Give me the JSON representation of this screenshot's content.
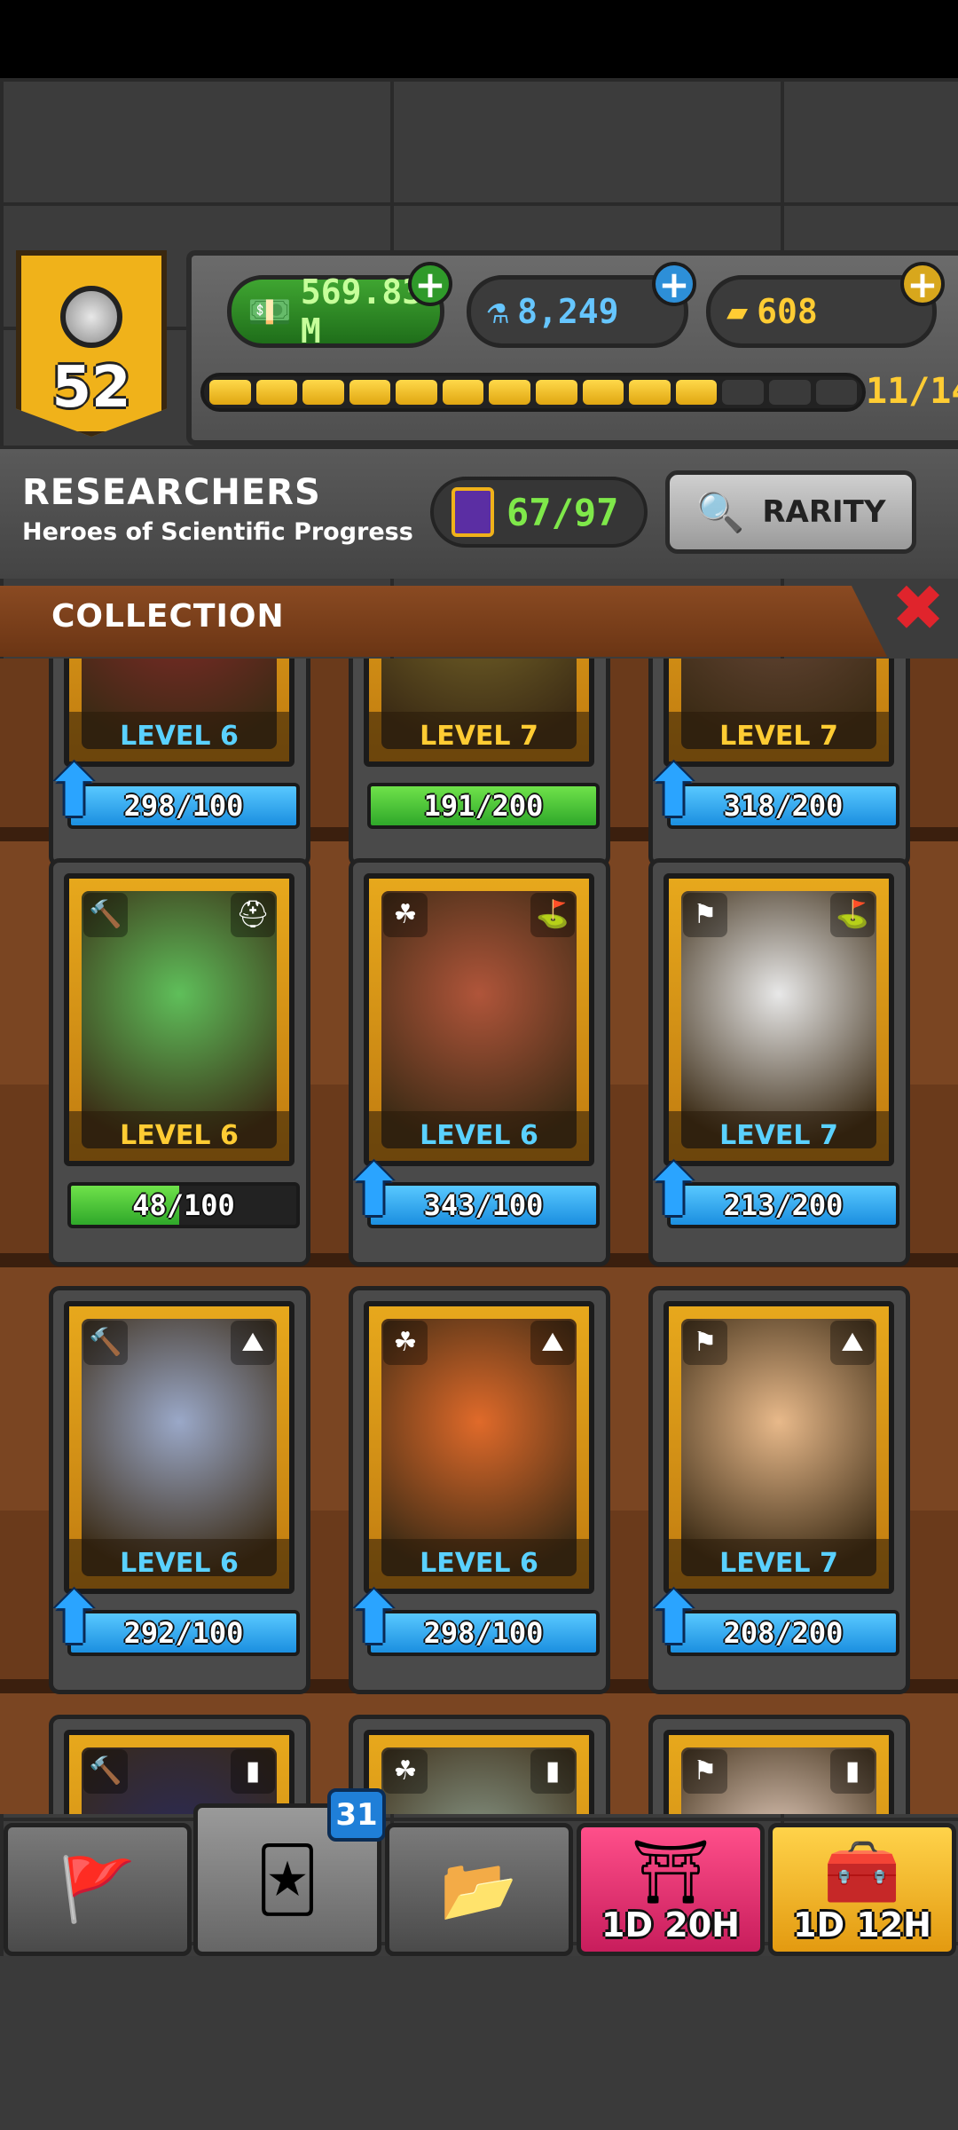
{
  "player": {
    "level": "52"
  },
  "currencies": {
    "cash": "569.83 M",
    "science": "8,249",
    "gold": "608"
  },
  "progress": {
    "text": "11/14",
    "filled": 11,
    "total": 14
  },
  "header": {
    "title": "RESEARCHERS",
    "subtitle": "Heroes of Scientific Progress",
    "cards_count": "67/97",
    "rarity_label": "RARITY"
  },
  "collection": {
    "label": "COLLECTION",
    "close": "✖"
  },
  "cards": [
    {
      "level": "LEVEL 6",
      "level_color": "blue",
      "progress": "298/100",
      "bar": "blue",
      "upgrade": true,
      "tint": "#8a2a2a"
    },
    {
      "level": "LEVEL 7",
      "level_color": "gold",
      "progress": "191/200",
      "bar": "green-full",
      "upgrade": false,
      "tint": "#7b6a2a"
    },
    {
      "level": "LEVEL 7",
      "level_color": "gold",
      "progress": "318/200",
      "bar": "blue",
      "upgrade": true,
      "tint": "#6b4a3a"
    },
    {
      "level": "LEVEL 6",
      "level_color": "gold",
      "progress": "48/100",
      "fill_fraction": 0.48,
      "bar": "partial",
      "upgrade": false,
      "tint": "#5fbf5a",
      "chip_l": "🔨",
      "chip_r": "⛑"
    },
    {
      "level": "LEVEL 6",
      "level_color": "blue",
      "progress": "343/100",
      "bar": "blue",
      "upgrade": true,
      "tint": "#b0553a",
      "chip_l": "☘",
      "chip_r": "⛳"
    },
    {
      "level": "LEVEL 7",
      "level_color": "blue",
      "progress": "213/200",
      "bar": "blue",
      "upgrade": true,
      "tint": "#e8e8e8",
      "chip_l": "⚑",
      "chip_r": "⛳"
    },
    {
      "level": "LEVEL 6",
      "level_color": "blue",
      "progress": "292/100",
      "bar": "blue",
      "upgrade": true,
      "tint": "#9aa8c8",
      "chip_l": "🔨",
      "chip_r": "⛰"
    },
    {
      "level": "LEVEL 6",
      "level_color": "blue",
      "progress": "298/100",
      "bar": "blue",
      "upgrade": true,
      "tint": "#e06a2a",
      "chip_l": "☘",
      "chip_r": "⛰"
    },
    {
      "level": "LEVEL 7",
      "level_color": "blue",
      "progress": "208/200",
      "bar": "blue",
      "upgrade": true,
      "tint": "#e8b98a",
      "chip_l": "⚑",
      "chip_r": "⛰"
    },
    {
      "level": "",
      "level_color": "blue",
      "progress": "",
      "bar": "blue",
      "upgrade": false,
      "tint": "#2a2a5a",
      "chip_l": "🔨",
      "chip_r": "▮"
    },
    {
      "level": "",
      "level_color": "blue",
      "progress": "",
      "bar": "blue",
      "upgrade": false,
      "tint": "#8a9a8a",
      "chip_l": "☘",
      "chip_r": "▮"
    },
    {
      "level": "",
      "level_color": "blue",
      "progress": "",
      "bar": "blue",
      "upgrade": false,
      "tint": "#e8d0c0",
      "chip_l": "⚑",
      "chip_r": "▮"
    }
  ],
  "nav": {
    "badge": "31",
    "timer1": "1D 20H",
    "timer2": "1D 12H"
  },
  "colors": {
    "accent_gold": "#f0b21a",
    "progress_blue": "#1b8fe0",
    "progress_green": "#2fa82a",
    "close_red": "#e0242c"
  }
}
